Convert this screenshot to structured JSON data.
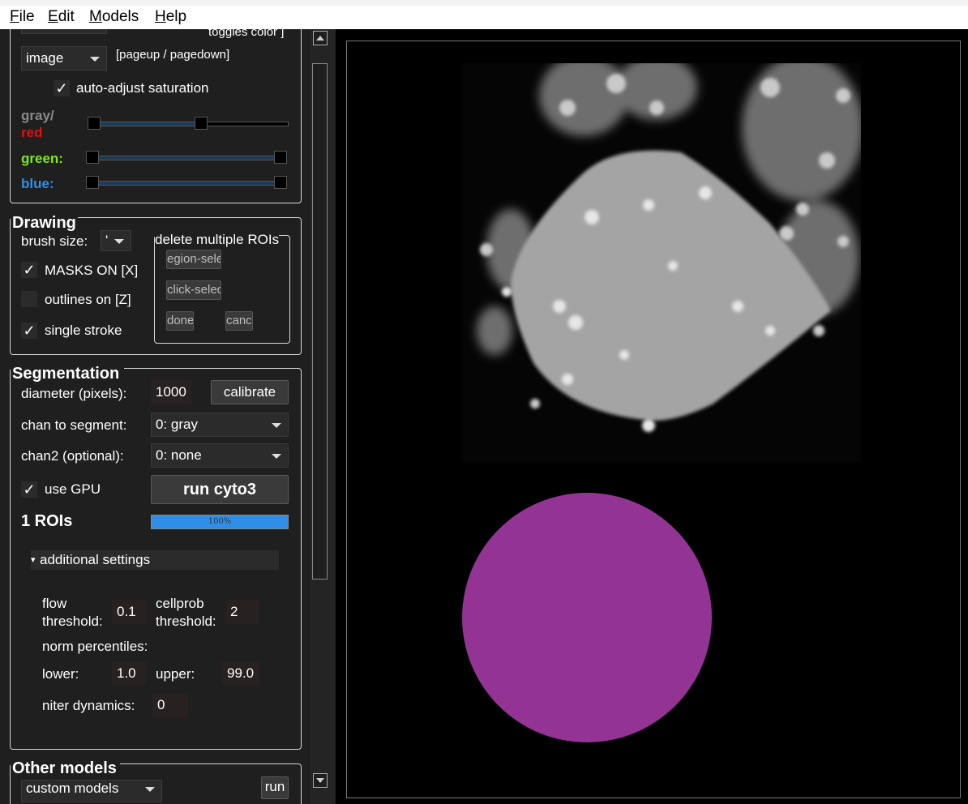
{
  "menu": [
    "File",
    "Edit",
    "Models",
    "Help"
  ],
  "color_section": {
    "toggle_hint": "toggles color ]",
    "view_select": "image",
    "page_hint": "[pageup / pagedown]",
    "auto_adjust_label": "auto-adjust saturation",
    "auto_adjust_checked": true,
    "gray_label": "gray/",
    "red_label": "red",
    "green_label": "green:",
    "blue_label": "blue:",
    "colors": {
      "gray": "#8a8a8a",
      "red": "#e01010",
      "green": "#7ee81a",
      "blue": "#2f8fe8"
    }
  },
  "drawing": {
    "title": "Drawing",
    "brush_label": "brush size:",
    "brush_value": "'",
    "masks_label": "MASKS ON [X]",
    "masks_checked": true,
    "outlines_label": "outlines on [Z]",
    "outlines_checked": false,
    "single_stroke_label": "single stroke",
    "single_stroke_checked": true,
    "delete_group_title": "delete multiple ROIs",
    "region_select": "egion-sele",
    "click_select": "click-selec",
    "done": "done",
    "cancel": "cance"
  },
  "segmentation": {
    "title": "Segmentation",
    "diameter_label": "diameter (pixels):",
    "diameter_value": "1000",
    "calibrate": "calibrate",
    "chan_label": "chan to segment:",
    "chan_value": "0: gray",
    "chan2_label": "chan2 (optional):",
    "chan2_value": "0: none",
    "use_gpu_label": "use GPU",
    "use_gpu_checked": true,
    "run_button": "run cyto3",
    "roi_count": "1 ROIs",
    "progress_text": "100%",
    "progress_value": 1.0,
    "additional_settings": "additional settings",
    "flow_label_1": "flow",
    "flow_label_2": "threshold:",
    "flow_value": "0.1",
    "cellprob_label_1": "cellprob",
    "cellprob_label_2": "threshold:",
    "cellprob_value": "2",
    "norm_label": "norm percentiles:",
    "lower_label": "lower:",
    "lower_value": "1.0",
    "upper_label": "upper:",
    "upper_value": "99.0",
    "niter_label": "niter dynamics:",
    "niter_value": "0"
  },
  "other_models": {
    "title": "Other models",
    "model_select": "custom models",
    "run": "run"
  },
  "viewer": {
    "mask_color": "#933494"
  }
}
